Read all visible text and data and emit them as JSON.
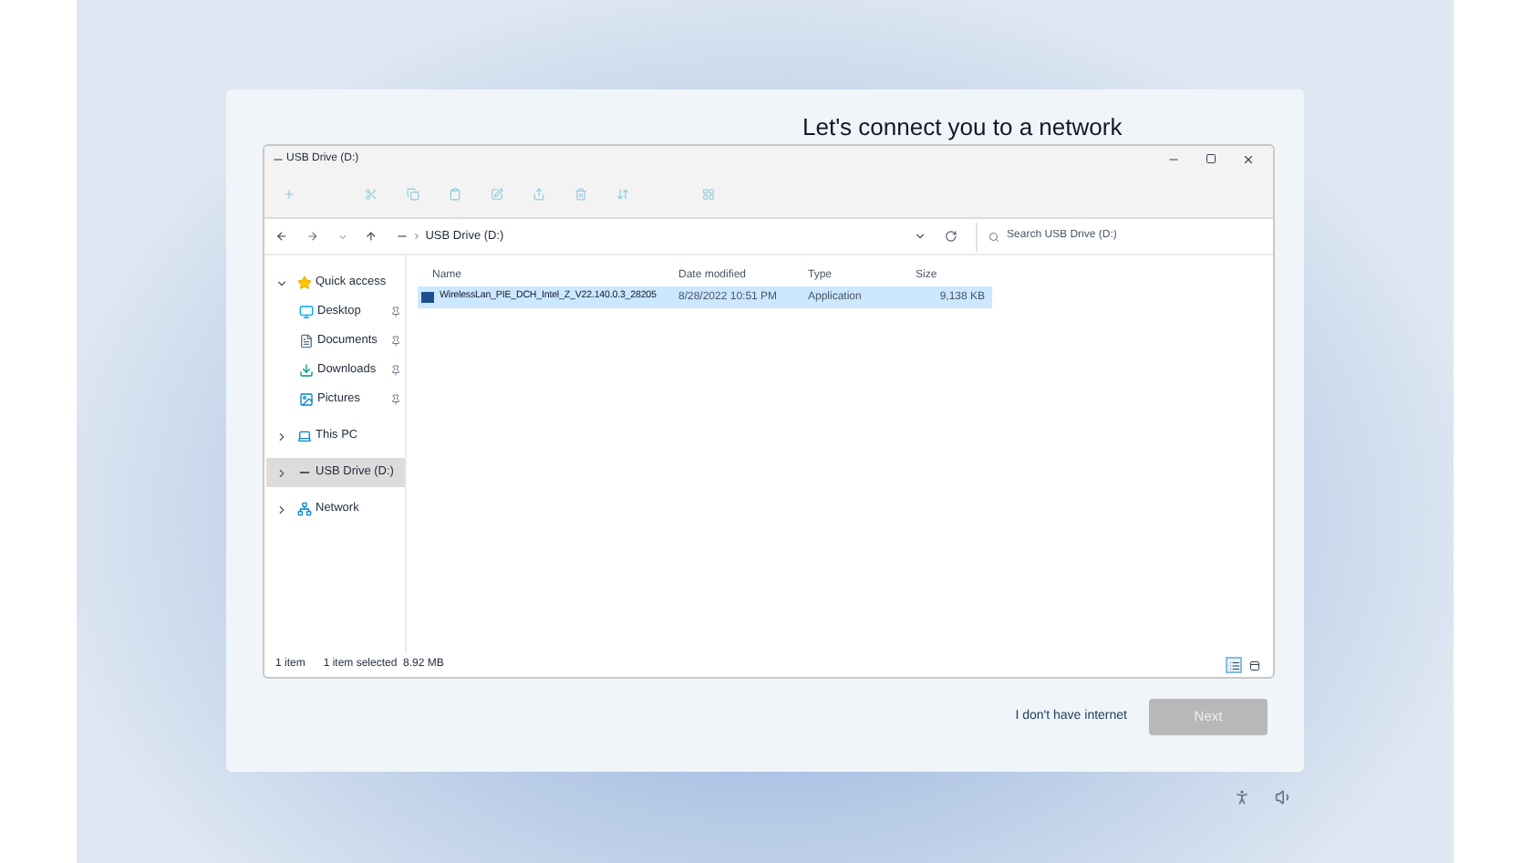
{
  "heading": "Let's connect you to a network",
  "window": {
    "title": "USB Drive (D:)"
  },
  "address": {
    "path": "USB Drive (D:)",
    "search_placeholder": "Search USB Drive (D:)"
  },
  "sidebar": {
    "items": [
      {
        "label": "Quick access",
        "kind": "star",
        "expanded": true,
        "selected": false,
        "children": [
          {
            "label": "Desktop",
            "kind": "desktop",
            "pinned": true,
            "selected": false
          },
          {
            "label": "Documents",
            "kind": "documents",
            "pinned": true,
            "selected": false
          },
          {
            "label": "Downloads",
            "kind": "downloads",
            "pinned": true,
            "selected": false
          },
          {
            "label": "Pictures",
            "kind": "pictures",
            "pinned": true,
            "selected": false
          }
        ]
      },
      {
        "label": "This PC",
        "kind": "pc",
        "expanded": false,
        "selected": false
      },
      {
        "label": "USB Drive (D:)",
        "kind": "drive",
        "expanded": false,
        "selected": true
      },
      {
        "label": "Network",
        "kind": "network",
        "expanded": false,
        "selected": false
      }
    ]
  },
  "table": {
    "columns": [
      "Name",
      "Date modified",
      "Type",
      "Size"
    ],
    "rows": [
      {
        "name": "WirelessLan_PIE_DCH_Intel_Z_V22.140.0.3_28205",
        "date": "8/28/2022 10:51 PM",
        "type": "Application",
        "size": "9,138 KB",
        "selected": true
      }
    ]
  },
  "status_bar": {
    "count": "1 item",
    "selection": "1 item selected  8.92 MB",
    "views": [
      {
        "kind": "details",
        "selected": true
      },
      {
        "kind": "tiles",
        "selected": false
      }
    ]
  },
  "footer": {
    "link": "I don't have internet",
    "next": {
      "label": "Next",
      "disabled": true
    }
  }
}
